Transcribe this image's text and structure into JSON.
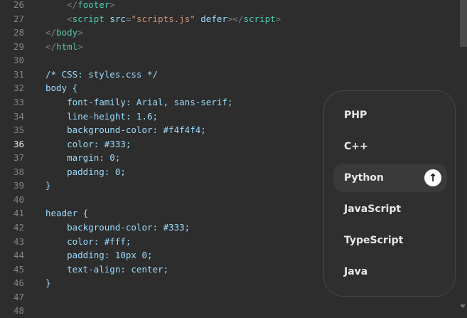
{
  "editor": {
    "active_line": 36,
    "lines": [
      {
        "n": 26,
        "tokens": [
          [
            "ind",
            "    "
          ],
          [
            "t-br",
            "</"
          ],
          [
            "t-tag",
            "footer"
          ],
          [
            "t-br",
            ">"
          ]
        ]
      },
      {
        "n": 27,
        "tokens": [
          [
            "ind",
            "    "
          ],
          [
            "t-br",
            "<"
          ],
          [
            "t-tag",
            "script"
          ],
          [
            "t-attr",
            " src"
          ],
          [
            "t-br",
            "="
          ],
          [
            "t-str",
            "\"scripts.js\""
          ],
          [
            "t-attr",
            " defer"
          ],
          [
            "t-br",
            "></"
          ],
          [
            "t-tag",
            "script"
          ],
          [
            "t-br",
            ">"
          ]
        ]
      },
      {
        "n": 28,
        "tokens": [
          [
            "t-br",
            "</"
          ],
          [
            "t-tag",
            "body"
          ],
          [
            "t-br",
            ">"
          ]
        ]
      },
      {
        "n": 29,
        "tokens": [
          [
            "t-br",
            "</"
          ],
          [
            "t-tag",
            "html"
          ],
          [
            "t-br",
            ">"
          ]
        ]
      },
      {
        "n": 30,
        "tokens": []
      },
      {
        "n": 31,
        "tokens": [
          [
            "t-css",
            "/* CSS: styles.css */"
          ]
        ]
      },
      {
        "n": 32,
        "tokens": [
          [
            "t-css",
            "body {"
          ]
        ]
      },
      {
        "n": 33,
        "tokens": [
          [
            "t-css",
            "    font-family: Arial, sans-serif;"
          ]
        ]
      },
      {
        "n": 34,
        "tokens": [
          [
            "t-css",
            "    line-height: 1.6;"
          ]
        ]
      },
      {
        "n": 35,
        "tokens": [
          [
            "t-css",
            "    background-color: #f4f4f4;"
          ]
        ]
      },
      {
        "n": 36,
        "tokens": [
          [
            "t-css",
            "    color: #333;"
          ]
        ]
      },
      {
        "n": 37,
        "tokens": [
          [
            "t-css",
            "    margin: 0;"
          ]
        ]
      },
      {
        "n": 38,
        "tokens": [
          [
            "t-css",
            "    padding: 0;"
          ]
        ]
      },
      {
        "n": 39,
        "tokens": [
          [
            "t-css",
            "}"
          ]
        ]
      },
      {
        "n": 40,
        "tokens": []
      },
      {
        "n": 41,
        "tokens": [
          [
            "t-css",
            "header {"
          ]
        ]
      },
      {
        "n": 42,
        "tokens": [
          [
            "t-css",
            "    background-color: #333;"
          ]
        ]
      },
      {
        "n": 43,
        "tokens": [
          [
            "t-css",
            "    color: #fff;"
          ]
        ]
      },
      {
        "n": 44,
        "tokens": [
          [
            "t-css",
            "    padding: 10px 0;"
          ]
        ]
      },
      {
        "n": 45,
        "tokens": [
          [
            "t-css",
            "    text-align: center;"
          ]
        ]
      },
      {
        "n": 46,
        "tokens": [
          [
            "t-css",
            "}"
          ]
        ]
      },
      {
        "n": 47,
        "tokens": []
      },
      {
        "n": 48,
        "tokens": []
      }
    ]
  },
  "menu": {
    "selected": "Python",
    "action_icon": "arrow-up-icon",
    "action_glyph": "↑",
    "items": [
      "PHP",
      "C++",
      "Python",
      "JavaScript",
      "TypeScript",
      "Java"
    ]
  }
}
